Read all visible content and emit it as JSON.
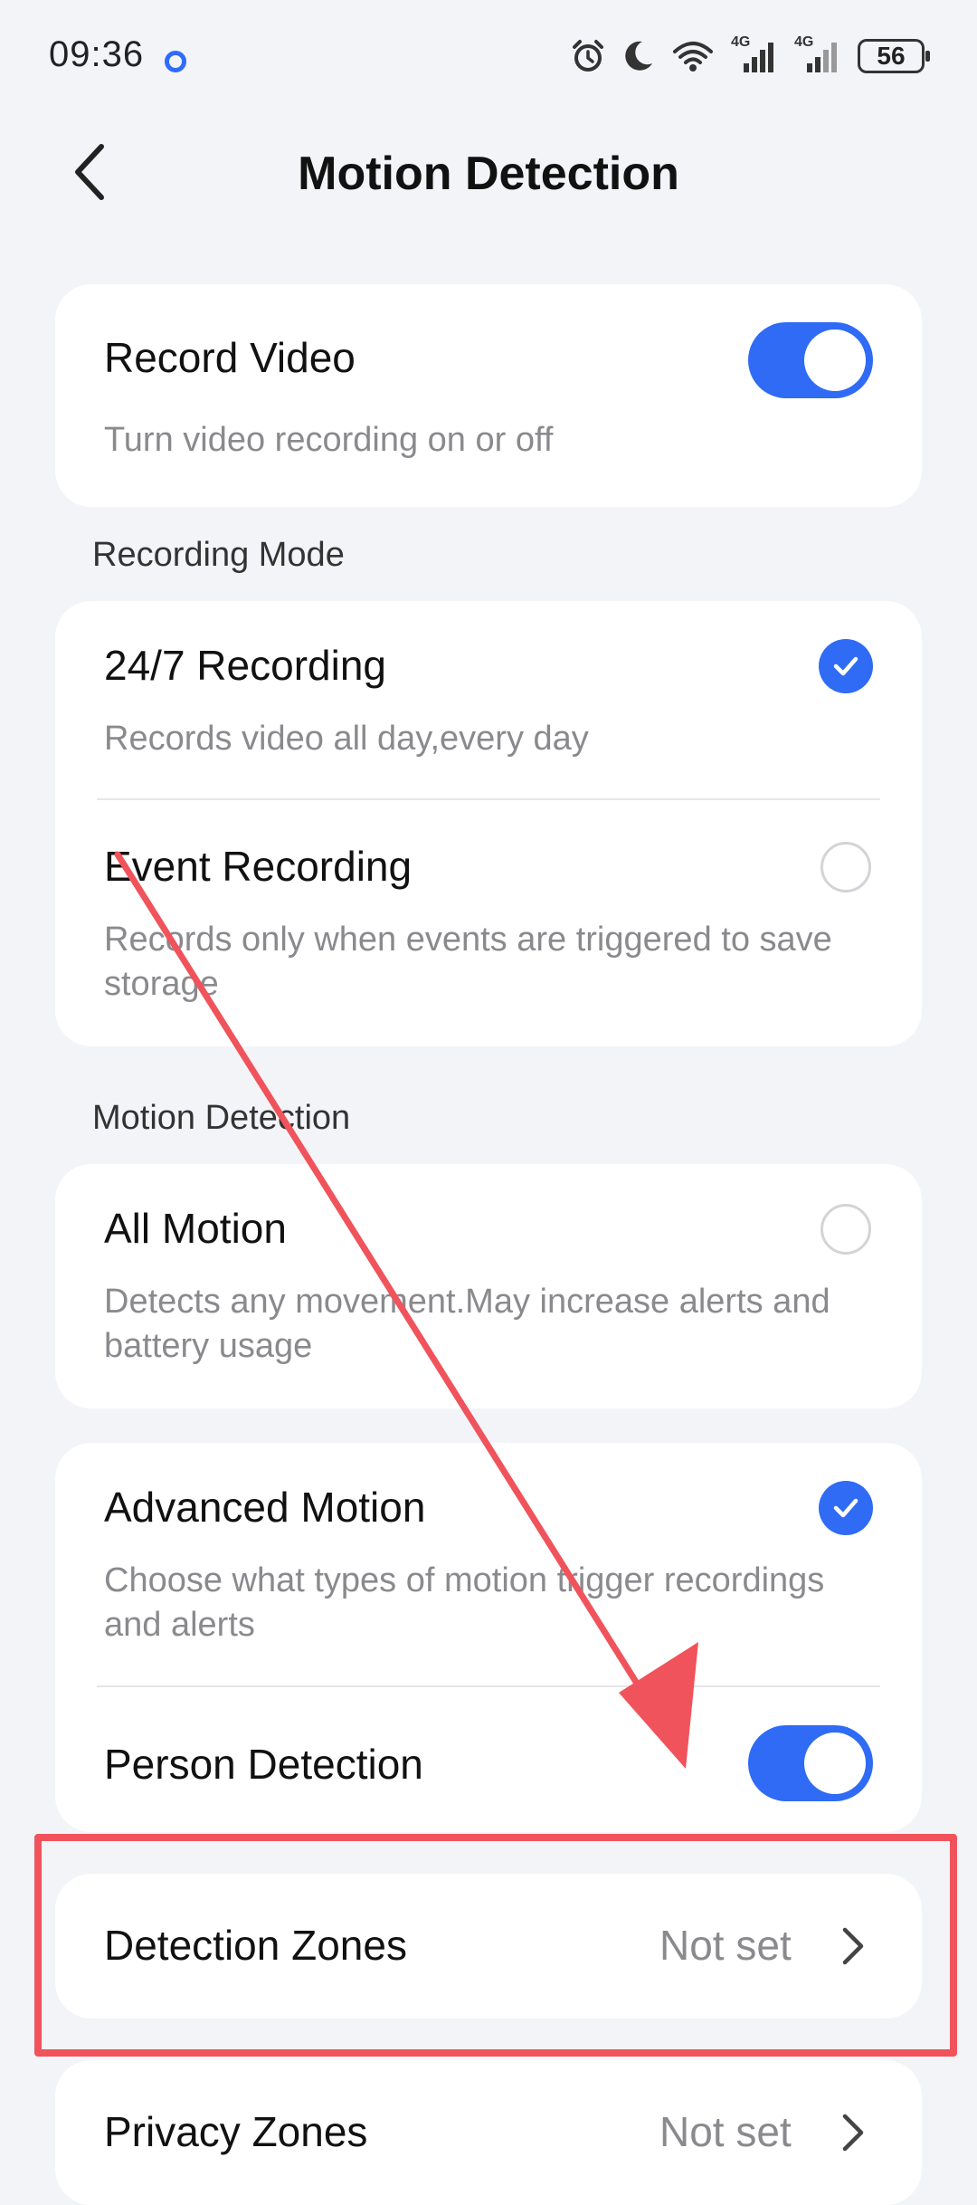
{
  "status_bar": {
    "time": "09:36",
    "battery": "56",
    "network_1": "4G",
    "network_2": "4G"
  },
  "header": {
    "title": "Motion Detection"
  },
  "record_video": {
    "title": "Record Video",
    "description": "Turn video recording on or off",
    "enabled": true
  },
  "recording_mode": {
    "section_label": "Recording Mode",
    "options": [
      {
        "title": "24/7 Recording",
        "description": "Records video all day,every day",
        "selected": true
      },
      {
        "title": "Event Recording",
        "description": "Records only when events are triggered to save storage",
        "selected": false
      }
    ]
  },
  "motion_detection": {
    "section_label": "Motion Detection",
    "all_motion": {
      "title": "All Motion",
      "description": "Detects any movement.May increase alerts and battery usage",
      "selected": false
    },
    "advanced_motion": {
      "title": "Advanced Motion",
      "description": "Choose what types of motion trigger recordings and alerts",
      "selected": true
    },
    "person_detection": {
      "title": "Person Detection",
      "enabled": true
    }
  },
  "zones": [
    {
      "title": "Detection Zones",
      "value": "Not set"
    },
    {
      "title": "Privacy Zones",
      "value": "Not set"
    }
  ],
  "colors": {
    "accent": "#2f6bf5",
    "annotation": "#f0535b",
    "background": "#f3f4f8"
  }
}
